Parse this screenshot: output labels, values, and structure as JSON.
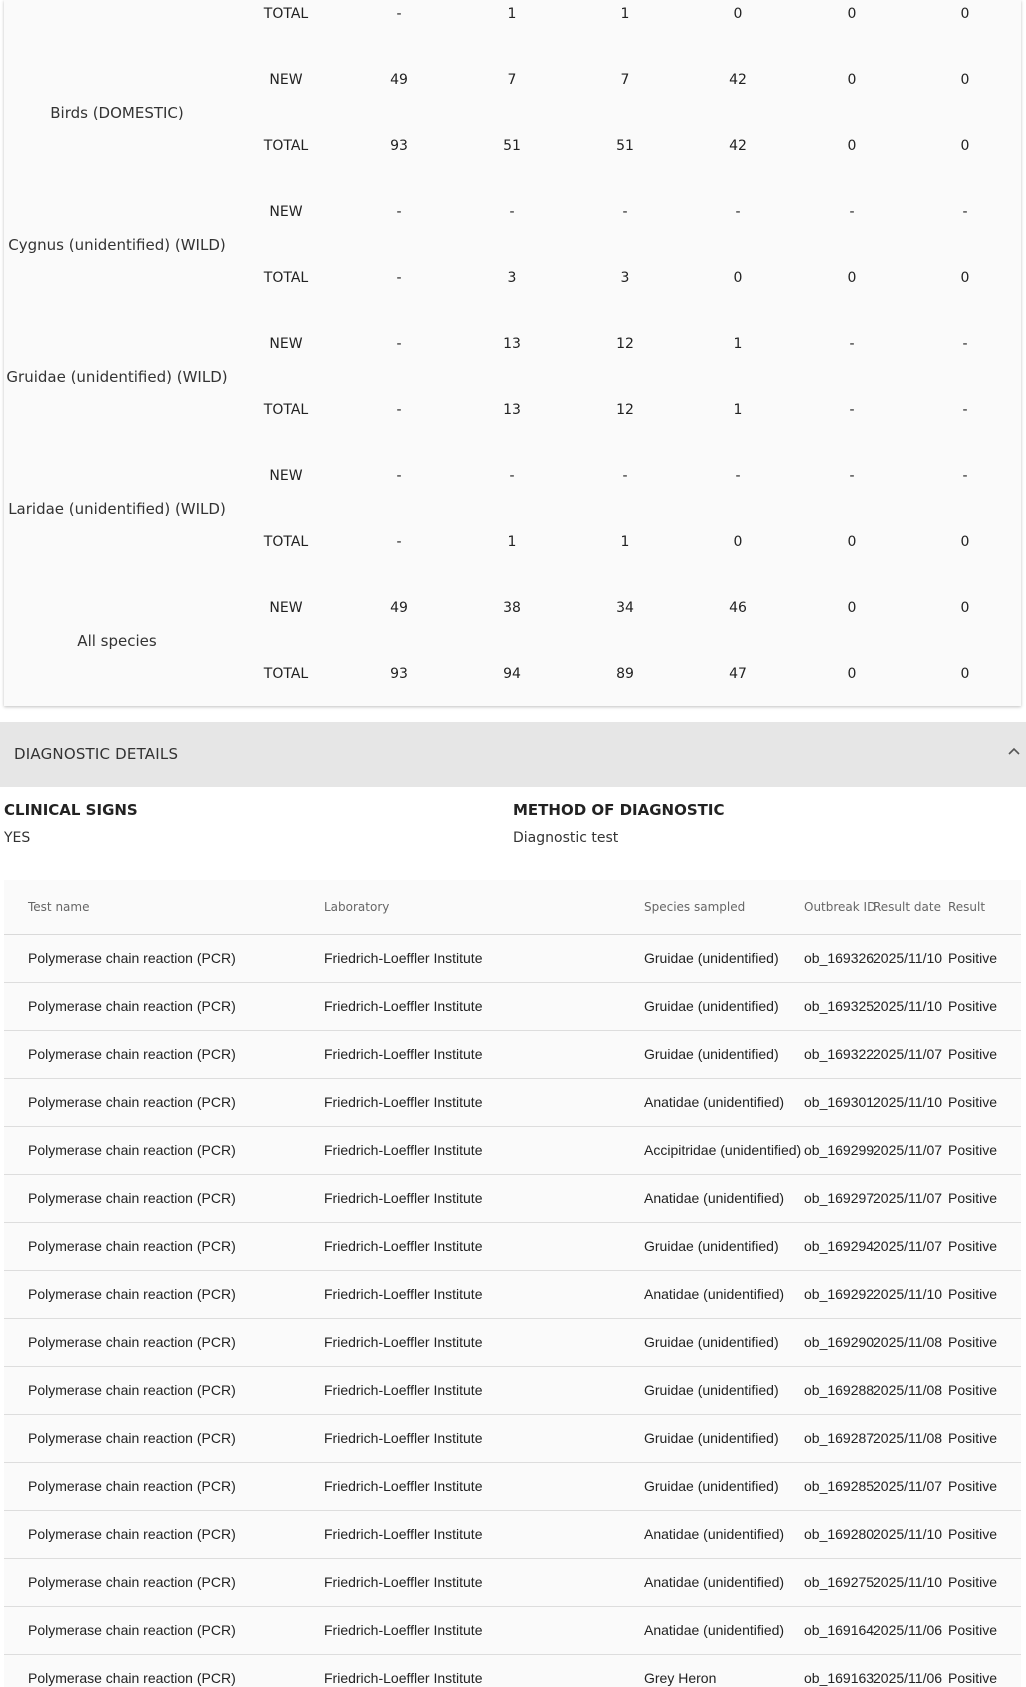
{
  "species_table": {
    "rows": [
      {
        "species": "Birds (DOMESTIC)",
        "new": [
          "49",
          "7",
          "7",
          "42",
          "0",
          "0"
        ],
        "total": [
          "93",
          "51",
          "51",
          "42",
          "0",
          "0"
        ]
      },
      {
        "species": "Cygnus (unidentified) (WILD)",
        "new": [
          "-",
          "-",
          "-",
          "-",
          "-",
          "-"
        ],
        "total": [
          "-",
          "3",
          "3",
          "0",
          "0",
          "0"
        ]
      },
      {
        "species": "Gruidae (unidentified) (WILD)",
        "new": [
          "-",
          "13",
          "12",
          "1",
          "-",
          "-"
        ],
        "total": [
          "-",
          "13",
          "12",
          "1",
          "-",
          "-"
        ]
      },
      {
        "species": "Laridae (unidentified) (WILD)",
        "new": [
          "-",
          "-",
          "-",
          "-",
          "-",
          "-"
        ],
        "total": [
          "-",
          "1",
          "1",
          "0",
          "0",
          "0"
        ]
      },
      {
        "species": "All species",
        "new": [
          "49",
          "38",
          "34",
          "46",
          "0",
          "0"
        ],
        "total": [
          "93",
          "94",
          "89",
          "47",
          "0",
          "0"
        ]
      }
    ],
    "partial_top_row": {
      "type": "TOTAL",
      "values": [
        "-",
        "1",
        "1",
        "0",
        "0",
        "0"
      ]
    },
    "new_label": "NEW",
    "total_label": "TOTAL"
  },
  "diagnostic": {
    "section_title": "DIAGNOSTIC DETAILS",
    "chevron_icon": "chevron-up-icon",
    "clinical_signs_label": "CLINICAL SIGNS",
    "clinical_signs_value": "YES",
    "method_label": "METHOD OF DIAGNOSTIC",
    "method_value": "Diagnostic test",
    "table": {
      "headers": [
        "Test name",
        "Laboratory",
        "Species sampled",
        "Outbreak ID",
        "Result date",
        "Result"
      ],
      "rows": [
        [
          "Polymerase chain reaction (PCR)",
          "Friedrich-Loeffler Institute",
          "Gruidae (unidentified)",
          "ob_169326",
          "2025/11/10",
          "Positive"
        ],
        [
          "Polymerase chain reaction (PCR)",
          "Friedrich-Loeffler Institute",
          "Gruidae (unidentified)",
          "ob_169325",
          "2025/11/10",
          "Positive"
        ],
        [
          "Polymerase chain reaction (PCR)",
          "Friedrich-Loeffler Institute",
          "Gruidae (unidentified)",
          "ob_169322",
          "2025/11/07",
          "Positive"
        ],
        [
          "Polymerase chain reaction (PCR)",
          "Friedrich-Loeffler Institute",
          "Anatidae (unidentified)",
          "ob_169301",
          "2025/11/10",
          "Positive"
        ],
        [
          "Polymerase chain reaction (PCR)",
          "Friedrich-Loeffler Institute",
          "Accipitridae (unidentified)",
          "ob_169299",
          "2025/11/07",
          "Positive"
        ],
        [
          "Polymerase chain reaction (PCR)",
          "Friedrich-Loeffler Institute",
          "Anatidae (unidentified)",
          "ob_169297",
          "2025/11/07",
          "Positive"
        ],
        [
          "Polymerase chain reaction (PCR)",
          "Friedrich-Loeffler Institute",
          "Gruidae (unidentified)",
          "ob_169294",
          "2025/11/07",
          "Positive"
        ],
        [
          "Polymerase chain reaction (PCR)",
          "Friedrich-Loeffler Institute",
          "Anatidae (unidentified)",
          "ob_169292",
          "2025/11/10",
          "Positive"
        ],
        [
          "Polymerase chain reaction (PCR)",
          "Friedrich-Loeffler Institute",
          "Gruidae (unidentified)",
          "ob_169290",
          "2025/11/08",
          "Positive"
        ],
        [
          "Polymerase chain reaction (PCR)",
          "Friedrich-Loeffler Institute",
          "Gruidae (unidentified)",
          "ob_169288",
          "2025/11/08",
          "Positive"
        ],
        [
          "Polymerase chain reaction (PCR)",
          "Friedrich-Loeffler Institute",
          "Gruidae (unidentified)",
          "ob_169287",
          "2025/11/08",
          "Positive"
        ],
        [
          "Polymerase chain reaction (PCR)",
          "Friedrich-Loeffler Institute",
          "Gruidae (unidentified)",
          "ob_169285",
          "2025/11/07",
          "Positive"
        ],
        [
          "Polymerase chain reaction (PCR)",
          "Friedrich-Loeffler Institute",
          "Anatidae (unidentified)",
          "ob_169280",
          "2025/11/10",
          "Positive"
        ],
        [
          "Polymerase chain reaction (PCR)",
          "Friedrich-Loeffler Institute",
          "Anatidae (unidentified)",
          "ob_169275",
          "2025/11/10",
          "Positive"
        ],
        [
          "Polymerase chain reaction (PCR)",
          "Friedrich-Loeffler Institute",
          "Anatidae (unidentified)",
          "ob_169164",
          "2025/11/06",
          "Positive"
        ],
        [
          "Polymerase chain reaction (PCR)",
          "Friedrich-Loeffler Institute",
          "Grey Heron",
          "ob_169163",
          "2025/11/06",
          "Positive"
        ]
      ]
    }
  }
}
